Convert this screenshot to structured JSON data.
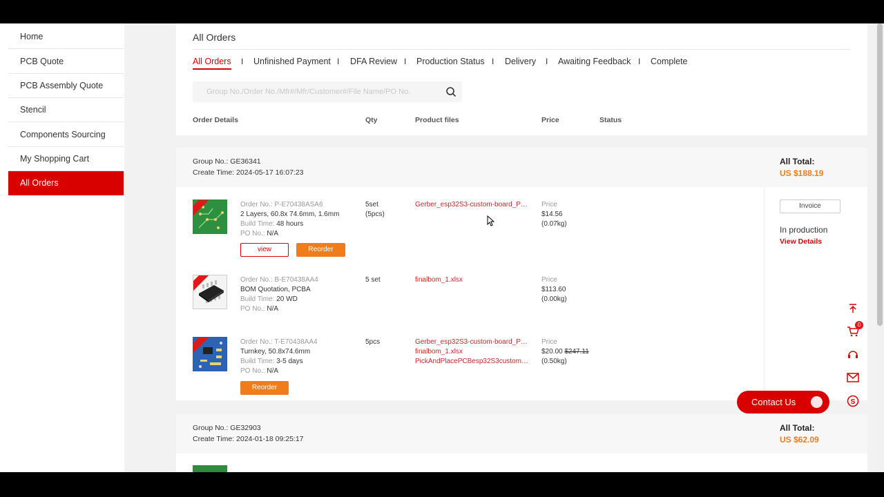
{
  "sidebar": {
    "items": [
      {
        "label": "Home"
      },
      {
        "label": "PCB Quote"
      },
      {
        "label": "PCB Assembly Quote"
      },
      {
        "label": "Stencil"
      },
      {
        "label": "Components Sourcing"
      },
      {
        "label": "My Shopping Cart"
      },
      {
        "label": "All Orders",
        "active": true
      }
    ]
  },
  "header": {
    "title": "All Orders",
    "tabs": [
      {
        "label": "All Orders",
        "active": true
      },
      {
        "label": "Unfinished Payment"
      },
      {
        "label": "DFA Review"
      },
      {
        "label": "Production Status"
      },
      {
        "label": "Delivery"
      },
      {
        "label": "Awaiting Feedback"
      },
      {
        "label": "Complete"
      }
    ],
    "tab_separator": "I",
    "search_placeholder": "Group No./Order No./Mfr#/Mfr/Customer#/File Name/PO No.",
    "columns": {
      "order_details": "Order Details",
      "qty": "Qty",
      "product_files": "Product files",
      "price": "Price",
      "status": "Status"
    }
  },
  "groups": [
    {
      "group_no": "Group No.: GE36341",
      "create_time": "Create Time: 2024-05-17 16:07:23",
      "total_label": "All Total:",
      "total": "US $188.19",
      "invoice_label": "Invoice",
      "status": "In production",
      "view_details": "View Details",
      "orders": [
        {
          "order_no_label": "Order No.:",
          "order_no": "P-E70438ASA6",
          "spec": "2 Layers, 60.8x 74.6mm, 1.6mm",
          "build_label": "Build Time:",
          "build_time": "48 hours",
          "po_label": "PO No.:",
          "po": "N/A",
          "qty_line1": "5set",
          "qty_line2": "(5pcs)",
          "files": [
            "Gerber_esp32S3-custom-board_PC..."
          ],
          "price_label": "Price",
          "price": "$14.56",
          "weight": "(0.07kg)",
          "view_label": "view",
          "reorder_label": "Reorder",
          "thumb": "pcb-green"
        },
        {
          "order_no_label": "Order No.:",
          "order_no": "B-E70438AA4",
          "spec": "BOM Quotation, PCBA",
          "build_label": "Build Time:",
          "build_time": "20 WD",
          "po_label": "PO No.:",
          "po": "N/A",
          "qty_line1": "5 set",
          "files": [
            "finalbom_1.xlsx"
          ],
          "price_label": "Price",
          "price": "$113.60",
          "weight": "(0.00kg)",
          "thumb": "ic-chip"
        },
        {
          "order_no_label": "Order No.:",
          "order_no": "T-E70438AA4",
          "spec": "Turnkey, 50.8x74.6mm",
          "build_label": "Build Time:",
          "build_time": "3-5 days",
          "po_label": "PO No.:",
          "po": "N/A",
          "qty_line1": "5pcs",
          "files": [
            "Gerber_esp32S3-custom-board_PC...",
            "finalbom_1.xlsx",
            "PickAndPlacePCBesp32S3custombo..."
          ],
          "price_label": "Price",
          "price": "$20.00",
          "old_price": "$247.11",
          "weight": "(0.50kg)",
          "reorder_label": "Reorder",
          "thumb": "pcba-blue"
        }
      ]
    },
    {
      "group_no": "Group No.: GE32903",
      "create_time": "Create Time: 2024-01-18 09:25:17",
      "total_label": "All Total:",
      "total": "US $62.09"
    }
  ],
  "floating": {
    "cart_count": "0",
    "contact_label": "Contact Us",
    "icons": [
      "arrow-up-icon",
      "cart-icon",
      "support-icon",
      "mail-icon",
      "skype-icon"
    ]
  },
  "colors": {
    "accent": "#d90000",
    "orange": "#f07d1a",
    "link_red": "#c62828"
  }
}
